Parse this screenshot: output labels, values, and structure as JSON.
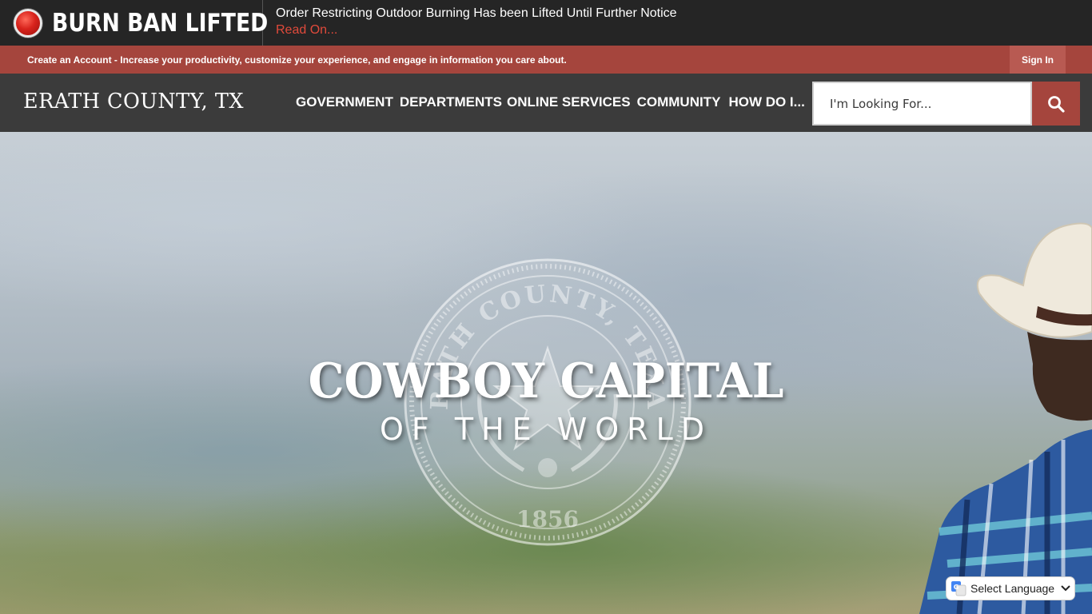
{
  "alert": {
    "heading": "BURN BAN LIFTED",
    "message": "Order Restricting Outdoor Burning Has been Lifted Until Further Notice",
    "link": "Read On..."
  },
  "account_bar": {
    "create_link": "Create an Account",
    "description": " - Increase your productivity, customize your experience, and engage in information you care about.",
    "sign_in": "Sign In"
  },
  "header": {
    "logo": "ERATH COUNTY, TX",
    "nav": [
      "GOVERNMENT",
      "DEPARTMENTS",
      "ONLINE SERVICES",
      "COMMUNITY",
      "HOW DO I..."
    ],
    "search": {
      "placeholder": "I'm Looking For...",
      "icon": "search-icon"
    }
  },
  "hero": {
    "title": "COWBOY CAPITAL",
    "subtitle": "OF THE WORLD",
    "seal": {
      "text": "ERATH COUNTY, TEXAS",
      "year": "1856"
    }
  },
  "translate": {
    "label": "Select Language",
    "icon": "google-translate-icon"
  },
  "colors": {
    "alert_background": "#252525",
    "alert_link": "#e14a3b",
    "account_bar": "#a5453d",
    "header": "#3b3b3b",
    "search_button": "#a5453d"
  }
}
